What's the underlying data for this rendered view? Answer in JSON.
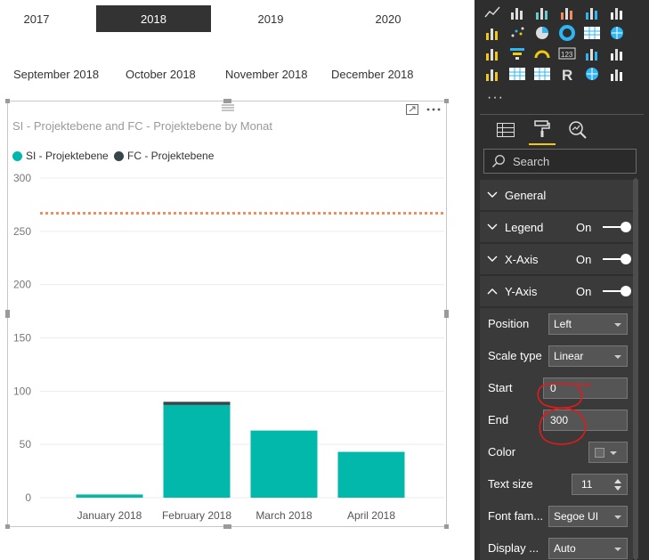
{
  "year_slicer": {
    "items": [
      "2017",
      "2018",
      "2019",
      "2020"
    ],
    "selected": "2018"
  },
  "month_slicer": {
    "items": [
      "September 2018",
      "October 2018",
      "November 2018",
      "December 2018"
    ]
  },
  "visual": {
    "title": "SI - Projektebene and FC - Projektebene by Monat",
    "legend": [
      {
        "label": "SI - Projektebene",
        "color": "#01b8aa"
      },
      {
        "label": "FC - Projektebene",
        "color": "#374649"
      }
    ]
  },
  "chart_data": {
    "type": "bar",
    "stacked": true,
    "categories": [
      "January 2018",
      "February 2018",
      "March 2018",
      "April 2018"
    ],
    "series": [
      {
        "name": "SI - Projektebene",
        "color": "#01b8aa",
        "values": [
          3,
          87,
          63,
          43
        ]
      },
      {
        "name": "FC - Projektebene",
        "color": "#374649",
        "values": [
          0,
          3,
          0,
          0
        ]
      }
    ],
    "y_ticks": [
      0,
      50,
      100,
      150,
      200,
      250,
      300
    ],
    "ylim": [
      0,
      300
    ],
    "reference_line": {
      "value": 267,
      "color": "#f28e5b",
      "style": "dotted"
    },
    "grid": true
  },
  "pane": {
    "tabs": [
      "fields-icon",
      "format-paintroller-icon",
      "analytics-magnifier-icon"
    ],
    "active_tab": "format-paintroller-icon",
    "search_placeholder": "Search",
    "sections": [
      {
        "label": "General",
        "state": "",
        "expanded": false
      },
      {
        "label": "Legend",
        "state": "On",
        "expanded": false
      },
      {
        "label": "X-Axis",
        "state": "On",
        "expanded": false
      },
      {
        "label": "Y-Axis",
        "state": "On",
        "expanded": true
      }
    ],
    "yaxis": {
      "position_label": "Position",
      "position_value": "Left",
      "scale_label": "Scale type",
      "scale_value": "Linear",
      "start_label": "Start",
      "start_value": "0",
      "end_label": "End",
      "end_value": "300",
      "color_label": "Color",
      "textsize_label": "Text size",
      "textsize_value": "11",
      "font_label": "Font fam...",
      "font_value": "Segoe UI",
      "display_label": "Display ...",
      "display_value": "Auto"
    },
    "annotation_color": "#e11b1b"
  }
}
